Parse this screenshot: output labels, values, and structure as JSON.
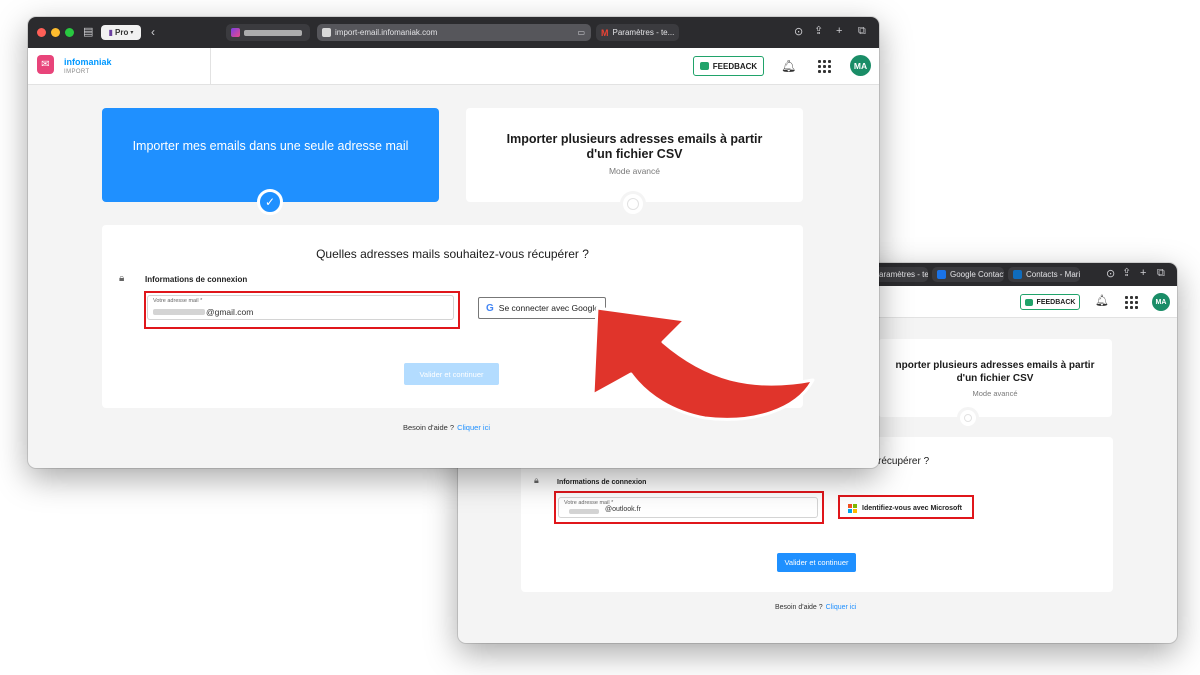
{
  "browser": {
    "profile_label": "Pro",
    "address_url": "import-email.infomaniak.com",
    "tab_gmail_label": "Paramètres - te...",
    "back_tab_1": "aramètres - te...",
    "back_tab_2": "Google Contacts",
    "back_tab_3": "Contacts - Mari..."
  },
  "header": {
    "brand_name": "infomaniak",
    "brand_sub": "IMPORT",
    "feedback_label": "FEEDBACK",
    "avatar_initials": "MA"
  },
  "front": {
    "card_single_title": "Importer mes emails dans une seule adresse mail",
    "card_csv_title": "Importer plusieurs adresses emails à partir d'un fichier CSV",
    "card_csv_sub": "Mode avancé",
    "question": "Quelles adresses mails souhaitez-vous récupérer ?",
    "info_label": "Informations de connexion",
    "email_label": "Votre adresse mail *",
    "email_value": "@gmail.com",
    "google_button": "Se connecter avec Google",
    "submit_label": "Valider et continuer",
    "help_text": "Besoin d'aide ?",
    "help_link": "Cliquer ici"
  },
  "back": {
    "card_csv_title": "nporter plusieurs adresses emails à partir d'un fichier CSV",
    "card_csv_sub": "Mode avancé",
    "question": "récupérer ?",
    "info_label": "Informations de connexion",
    "email_label": "Votre adresse mail *",
    "email_value": "@outlook.fr",
    "microsoft_button": "Identifiez-vous avec Microsoft",
    "submit_label": "Valider et continuer",
    "help_text": "Besoin d'aide ?",
    "help_link": "Cliquer ici"
  },
  "colors": {
    "accent_blue": "#1f90ff",
    "highlight_red": "#e0161b",
    "feedback_green": "#20a36a",
    "avatar_green": "#1a8d67",
    "submit_disabled": "#b3dcff"
  },
  "icons": [
    "sidebar-icon",
    "chevron-left-icon",
    "download-icon",
    "share-icon",
    "plus-icon",
    "tabs-icon",
    "bell-icon",
    "apps-grid-icon",
    "lock-icon",
    "google-icon",
    "microsoft-icon",
    "checkmark-icon",
    "curved-arrow-icon"
  ]
}
